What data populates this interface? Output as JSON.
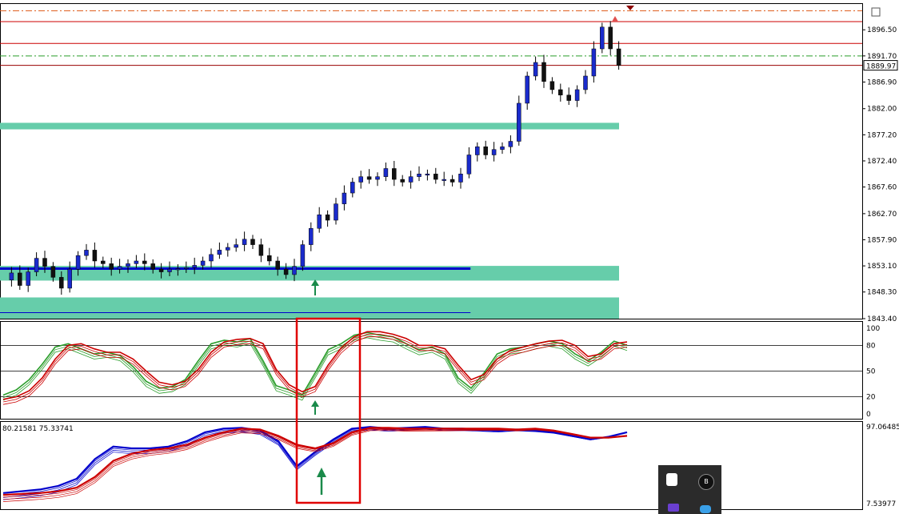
{
  "chart_data": [
    {
      "type": "candlestick",
      "title": "",
      "ylim": [
        1843.4,
        1901.4
      ],
      "y_ticks": [
        "1896.50",
        "1891.70",
        "1886.90",
        "1882.00",
        "1877.20",
        "1872.40",
        "1867.60",
        "1862.70",
        "1857.90",
        "1853.10",
        "1848.30",
        "1843.40"
      ],
      "current_price_label": "1889.97",
      "price_path": [
        1850.5,
        1851.8,
        1849.5,
        1852.0,
        1854.5,
        1853.0,
        1851.0,
        1849.0,
        1852.5,
        1855.0,
        1856.0,
        1854.0,
        1853.5,
        1852.5,
        1853.0,
        1853.5,
        1854.0,
        1853.5,
        1852.5,
        1852.0,
        1852.5,
        1852.6,
        1852.8,
        1853.2,
        1854.0,
        1855.2,
        1856.0,
        1856.5,
        1857.0,
        1858.0,
        1857.0,
        1855.0,
        1854.0,
        1852.5,
        1851.5,
        1853.0,
        1857.0,
        1860.0,
        1862.5,
        1861.5,
        1864.5,
        1866.5,
        1868.5,
        1869.5,
        1869.0,
        1869.5,
        1871.0,
        1869.0,
        1868.5,
        1869.5,
        1870.0,
        1870.0,
        1869.0,
        1869.0,
        1868.5,
        1870.0,
        1873.5,
        1875.0,
        1873.5,
        1874.5,
        1875.0,
        1876.0,
        1883.0,
        1888.0,
        1890.5,
        1887.0,
        1885.5,
        1884.5,
        1883.5,
        1885.5,
        1888.0,
        1893.0,
        1897.0,
        1893.0,
        1889.97
      ],
      "levels": [
        {
          "price": 1900.0,
          "style": "dash-dot",
          "color": "#e06020"
        },
        {
          "price": 1898.0,
          "style": "solid",
          "color": "#cc0000"
        },
        {
          "price": 1894.0,
          "style": "solid",
          "color": "#cc0000"
        },
        {
          "price": 1891.7,
          "style": "dash-dot",
          "color": "#2a9d2a"
        },
        {
          "price": 1889.97,
          "style": "solid",
          "color": "#990000"
        },
        {
          "price": 1852.6,
          "style": "solid",
          "color": "#0000cc",
          "x_start": 0.0,
          "x_end": 0.76
        },
        {
          "price": 1844.5,
          "style": "solid",
          "color": "#0000cc",
          "x_start": 0.0,
          "x_end": 0.76
        }
      ],
      "zones": [
        {
          "from": 1878.2,
          "to": 1879.4,
          "color": "#66cdaa"
        },
        {
          "from": 1850.4,
          "to": 1853.1,
          "color": "#66cdaa"
        },
        {
          "from": 1843.4,
          "to": 1847.3,
          "color": "#66cdaa"
        }
      ]
    },
    {
      "type": "line",
      "title": "",
      "ylim": [
        0,
        100
      ],
      "y_ticks": [
        "100",
        "80",
        "50",
        "20",
        "0"
      ],
      "levels": [
        80,
        50,
        20
      ],
      "series": [
        {
          "color": "#2a9d2a",
          "values": [
            22,
            28,
            40,
            58,
            78,
            82,
            76,
            70,
            72,
            68,
            55,
            38,
            30,
            32,
            40,
            62,
            82,
            86,
            84,
            88,
            62,
            33,
            28,
            22,
            48,
            75,
            82,
            92,
            95,
            92,
            90,
            82,
            75,
            78,
            70,
            42,
            30,
            48,
            70,
            76,
            78,
            82,
            85,
            82,
            70,
            62,
            72,
            85,
            80
          ]
        },
        {
          "color": "#cc0000",
          "values": [
            15,
            18,
            25,
            40,
            62,
            78,
            80,
            74,
            70,
            70,
            62,
            48,
            35,
            32,
            36,
            50,
            70,
            82,
            85,
            86,
            80,
            50,
            32,
            24,
            30,
            55,
            75,
            88,
            94,
            94,
            91,
            86,
            78,
            78,
            74,
            55,
            38,
            44,
            62,
            72,
            76,
            80,
            83,
            84,
            78,
            65,
            68,
            80,
            82
          ]
        }
      ]
    },
    {
      "type": "line",
      "title": "",
      "header_values": [
        "80.21581",
        "75.33741"
      ],
      "ylim": [
        7.53977,
        97.06485
      ],
      "y_ticks": [
        "97.06485",
        "7.53977"
      ],
      "series": [
        {
          "color": "#0000cc",
          "values": [
            22,
            24,
            26,
            30,
            38,
            60,
            74,
            72,
            72,
            74,
            80,
            90,
            94,
            95,
            92,
            80,
            52,
            68,
            82,
            94,
            96,
            94,
            95,
            96,
            94,
            94,
            93,
            92,
            93,
            92,
            90,
            86,
            82,
            85,
            90
          ]
        },
        {
          "color": "#cc0000",
          "values": [
            20,
            21,
            22,
            24,
            28,
            40,
            58,
            66,
            70,
            72,
            76,
            84,
            90,
            94,
            93,
            86,
            76,
            72,
            78,
            90,
            95,
            95,
            94,
            94,
            94,
            94,
            94,
            94,
            93,
            94,
            92,
            88,
            84,
            84,
            86
          ]
        }
      ]
    }
  ]
}
